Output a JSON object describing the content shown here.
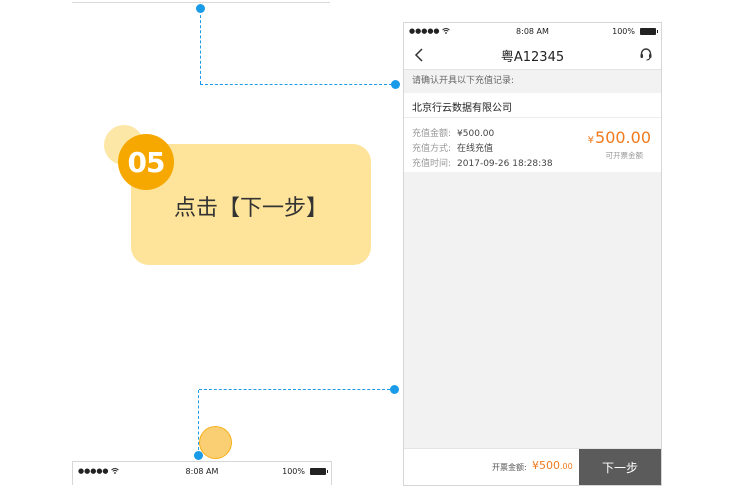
{
  "step": {
    "number": "05",
    "instruction": "点击【下一步】"
  },
  "status_bar": {
    "signal": "●●●●● ",
    "time": "8:08 AM",
    "battery": "100%"
  },
  "nav": {
    "title": "粤A12345"
  },
  "notice": "请确认开具以下充值记录:",
  "company": "北京行云数据有限公司",
  "record": {
    "amount_label": "充值金额:",
    "amount_value": "¥500.00",
    "method_label": "充值方式:",
    "method_value": "在线充值",
    "time_label": "充值时间:",
    "time_value": "2017-09-26 18:28:38",
    "big_currency": "¥",
    "big_amount": "500.00",
    "big_note": "可开票金额"
  },
  "bottom": {
    "total_label": "开票金额:",
    "total_currency": "¥",
    "total_integer": "500",
    "total_decimal": ".00",
    "next_label": "下一步"
  },
  "next_status_bar": {
    "signal": "●●●●● ",
    "time": "8:08 AM",
    "battery": "100%"
  },
  "colors": {
    "accent_blue": "#1a9be8",
    "badge_orange": "#f6a800",
    "card_yellow": "#fee39a",
    "amount_orange": "#f07a1e",
    "button_gray": "#5b5b5b"
  },
  "icons": [
    "back-chevron-icon",
    "headset-icon",
    "wifi-icon",
    "battery-icon"
  ]
}
